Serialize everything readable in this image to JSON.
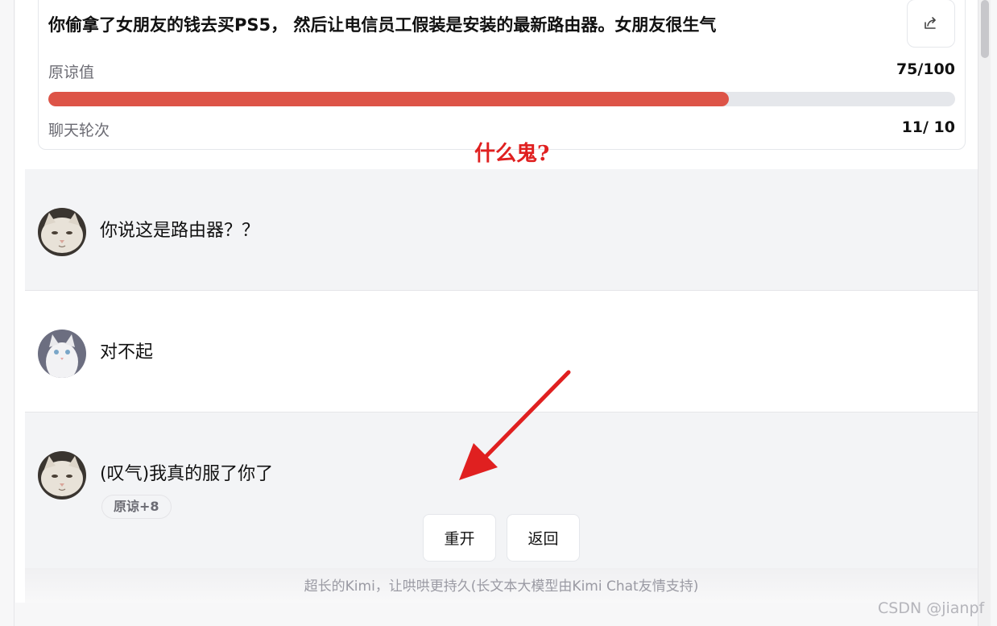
{
  "header": {
    "title": "你偷拿了女朋友的钱去买PS5， 然后让电信员工假装是安装的最新路由器。女朋友很生气",
    "forgiveness_label": "原谅值",
    "forgiveness_value": "75/100",
    "forgiveness_progress": 0.75,
    "rounds_label": "聊天轮次",
    "rounds_value": "11/ 10",
    "share_icon": "share-icon"
  },
  "annotation": "什么鬼?",
  "messages": [
    {
      "text": "你说这是路由器？？",
      "avatar": "cat-avatar"
    },
    {
      "text": "对不起",
      "avatar": "white-cat-avatar"
    },
    {
      "text": "(叹气)我真的服了你了",
      "avatar": "cat-avatar",
      "badge": "原谅+8"
    }
  ],
  "actions": {
    "restart": "重开",
    "back": "返回"
  },
  "footer": "超长的Kimi，让哄哄更持久(长文本大模型由Kimi Chat友情支持)",
  "watermark": "CSDN @jianpf",
  "colors": {
    "progress": "#dd5447",
    "annotation": "#e02020"
  }
}
